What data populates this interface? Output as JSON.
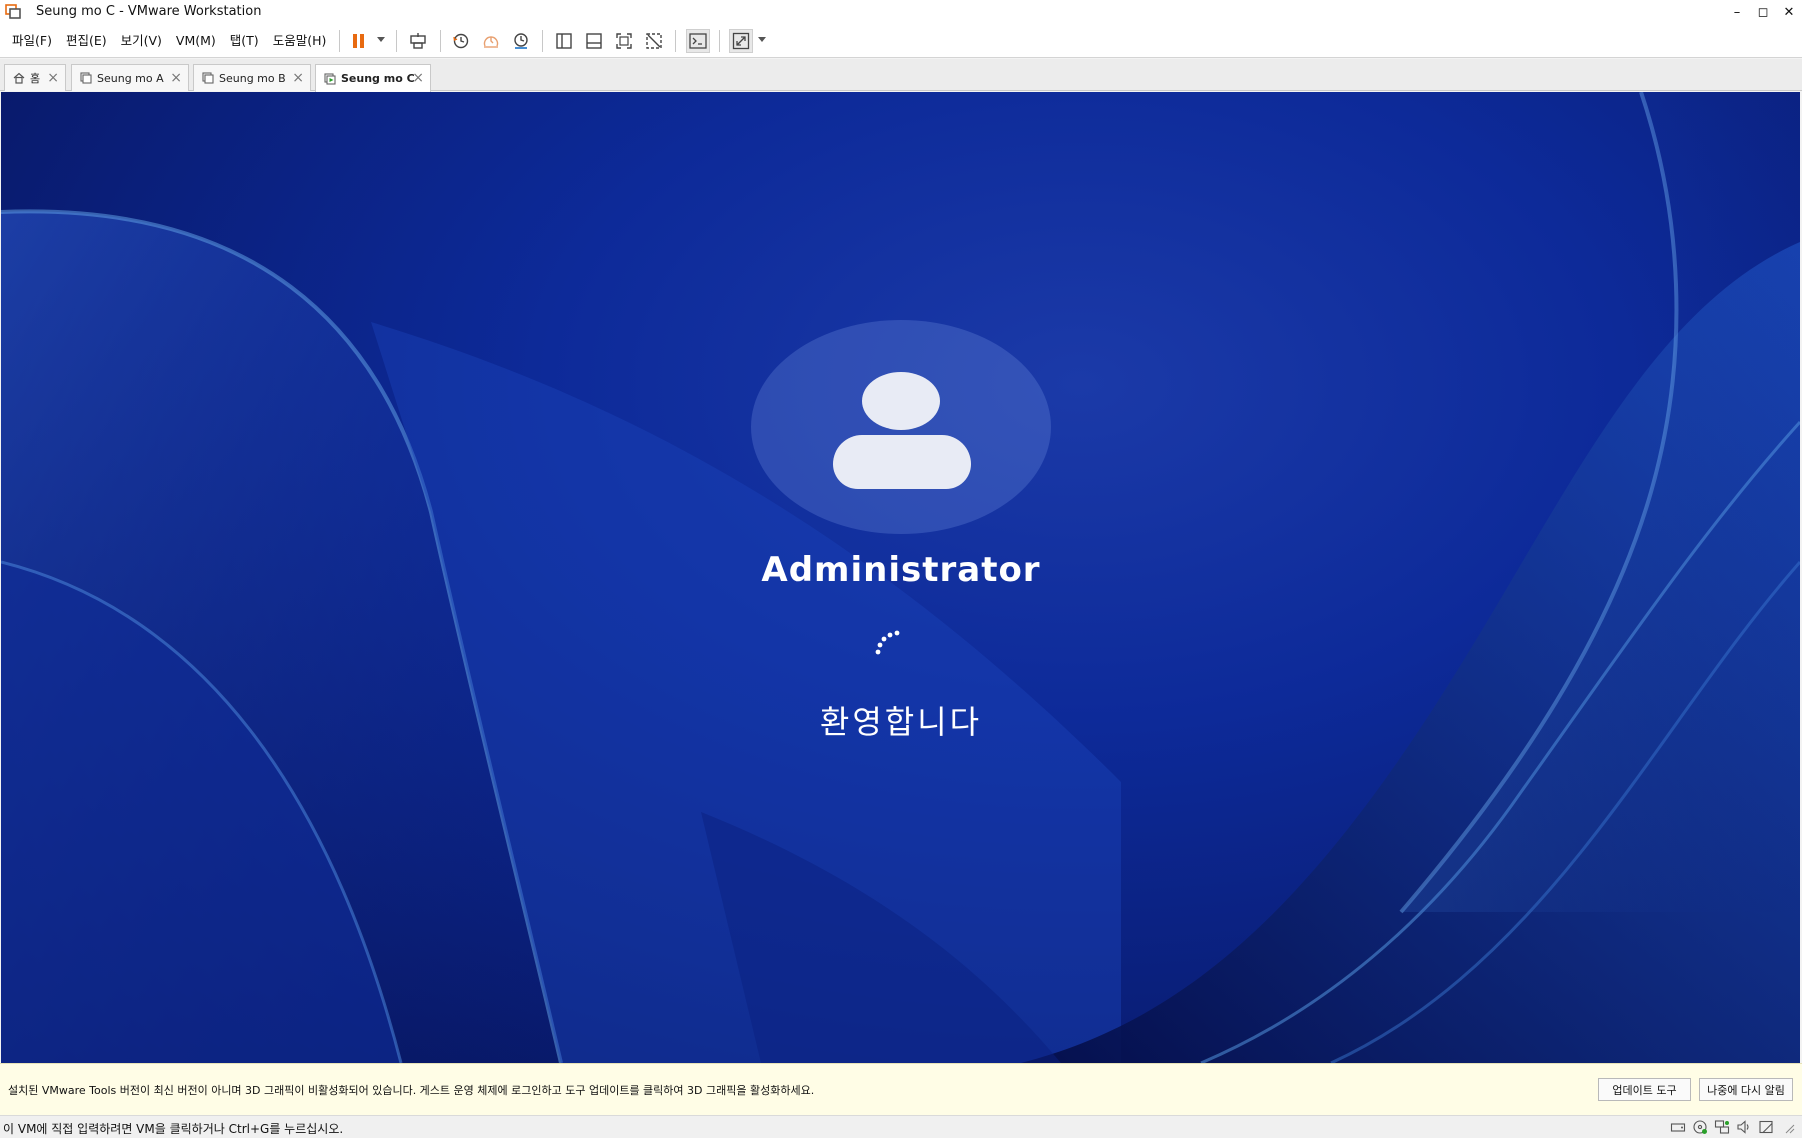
{
  "window": {
    "title": "Seung mo C - VMware Workstation",
    "controls": {
      "minimize": "–",
      "maximize": "◻",
      "close": "✕"
    }
  },
  "menu": {
    "items": [
      "파일(F)",
      "편집(E)",
      "보기(V)",
      "VM(M)",
      "탭(T)",
      "도움말(H)"
    ]
  },
  "toolbar": {
    "icons": [
      "pause-icon",
      "send-ctrl-alt-del-icon",
      "snapshot-icon",
      "revert-snapshot-icon",
      "snapshot-manager-icon",
      "show-library-icon",
      "thumbnail-bar-icon",
      "full-screen-icon",
      "unity-icon",
      "console-icon",
      "stretch-guest-icon"
    ],
    "accent": "#e86a10"
  },
  "tabs": [
    {
      "label": "홈",
      "active": false
    },
    {
      "label": "Seung mo A",
      "active": false
    },
    {
      "label": "Seung mo B",
      "active": false
    },
    {
      "label": "Seung mo C",
      "active": true
    }
  ],
  "guest": {
    "username": "Administrator",
    "welcome": "환영합니다"
  },
  "notification": {
    "message": "설치된 VMware Tools 버전이 최신 버전이 아니며 3D 그래픽이 비활성화되어 있습니다. 게스트 운영 체제에 로그인하고 도구 업데이트를 클릭하여 3D 그래픽을 활성화하세요.",
    "update_button": "업데이트 도구",
    "remind_later_button": "나중에 다시 알림"
  },
  "status": {
    "hint": "이 VM에 직접 입력하려면 VM을 클릭하거나 Ctrl+G를 누르십시오."
  }
}
